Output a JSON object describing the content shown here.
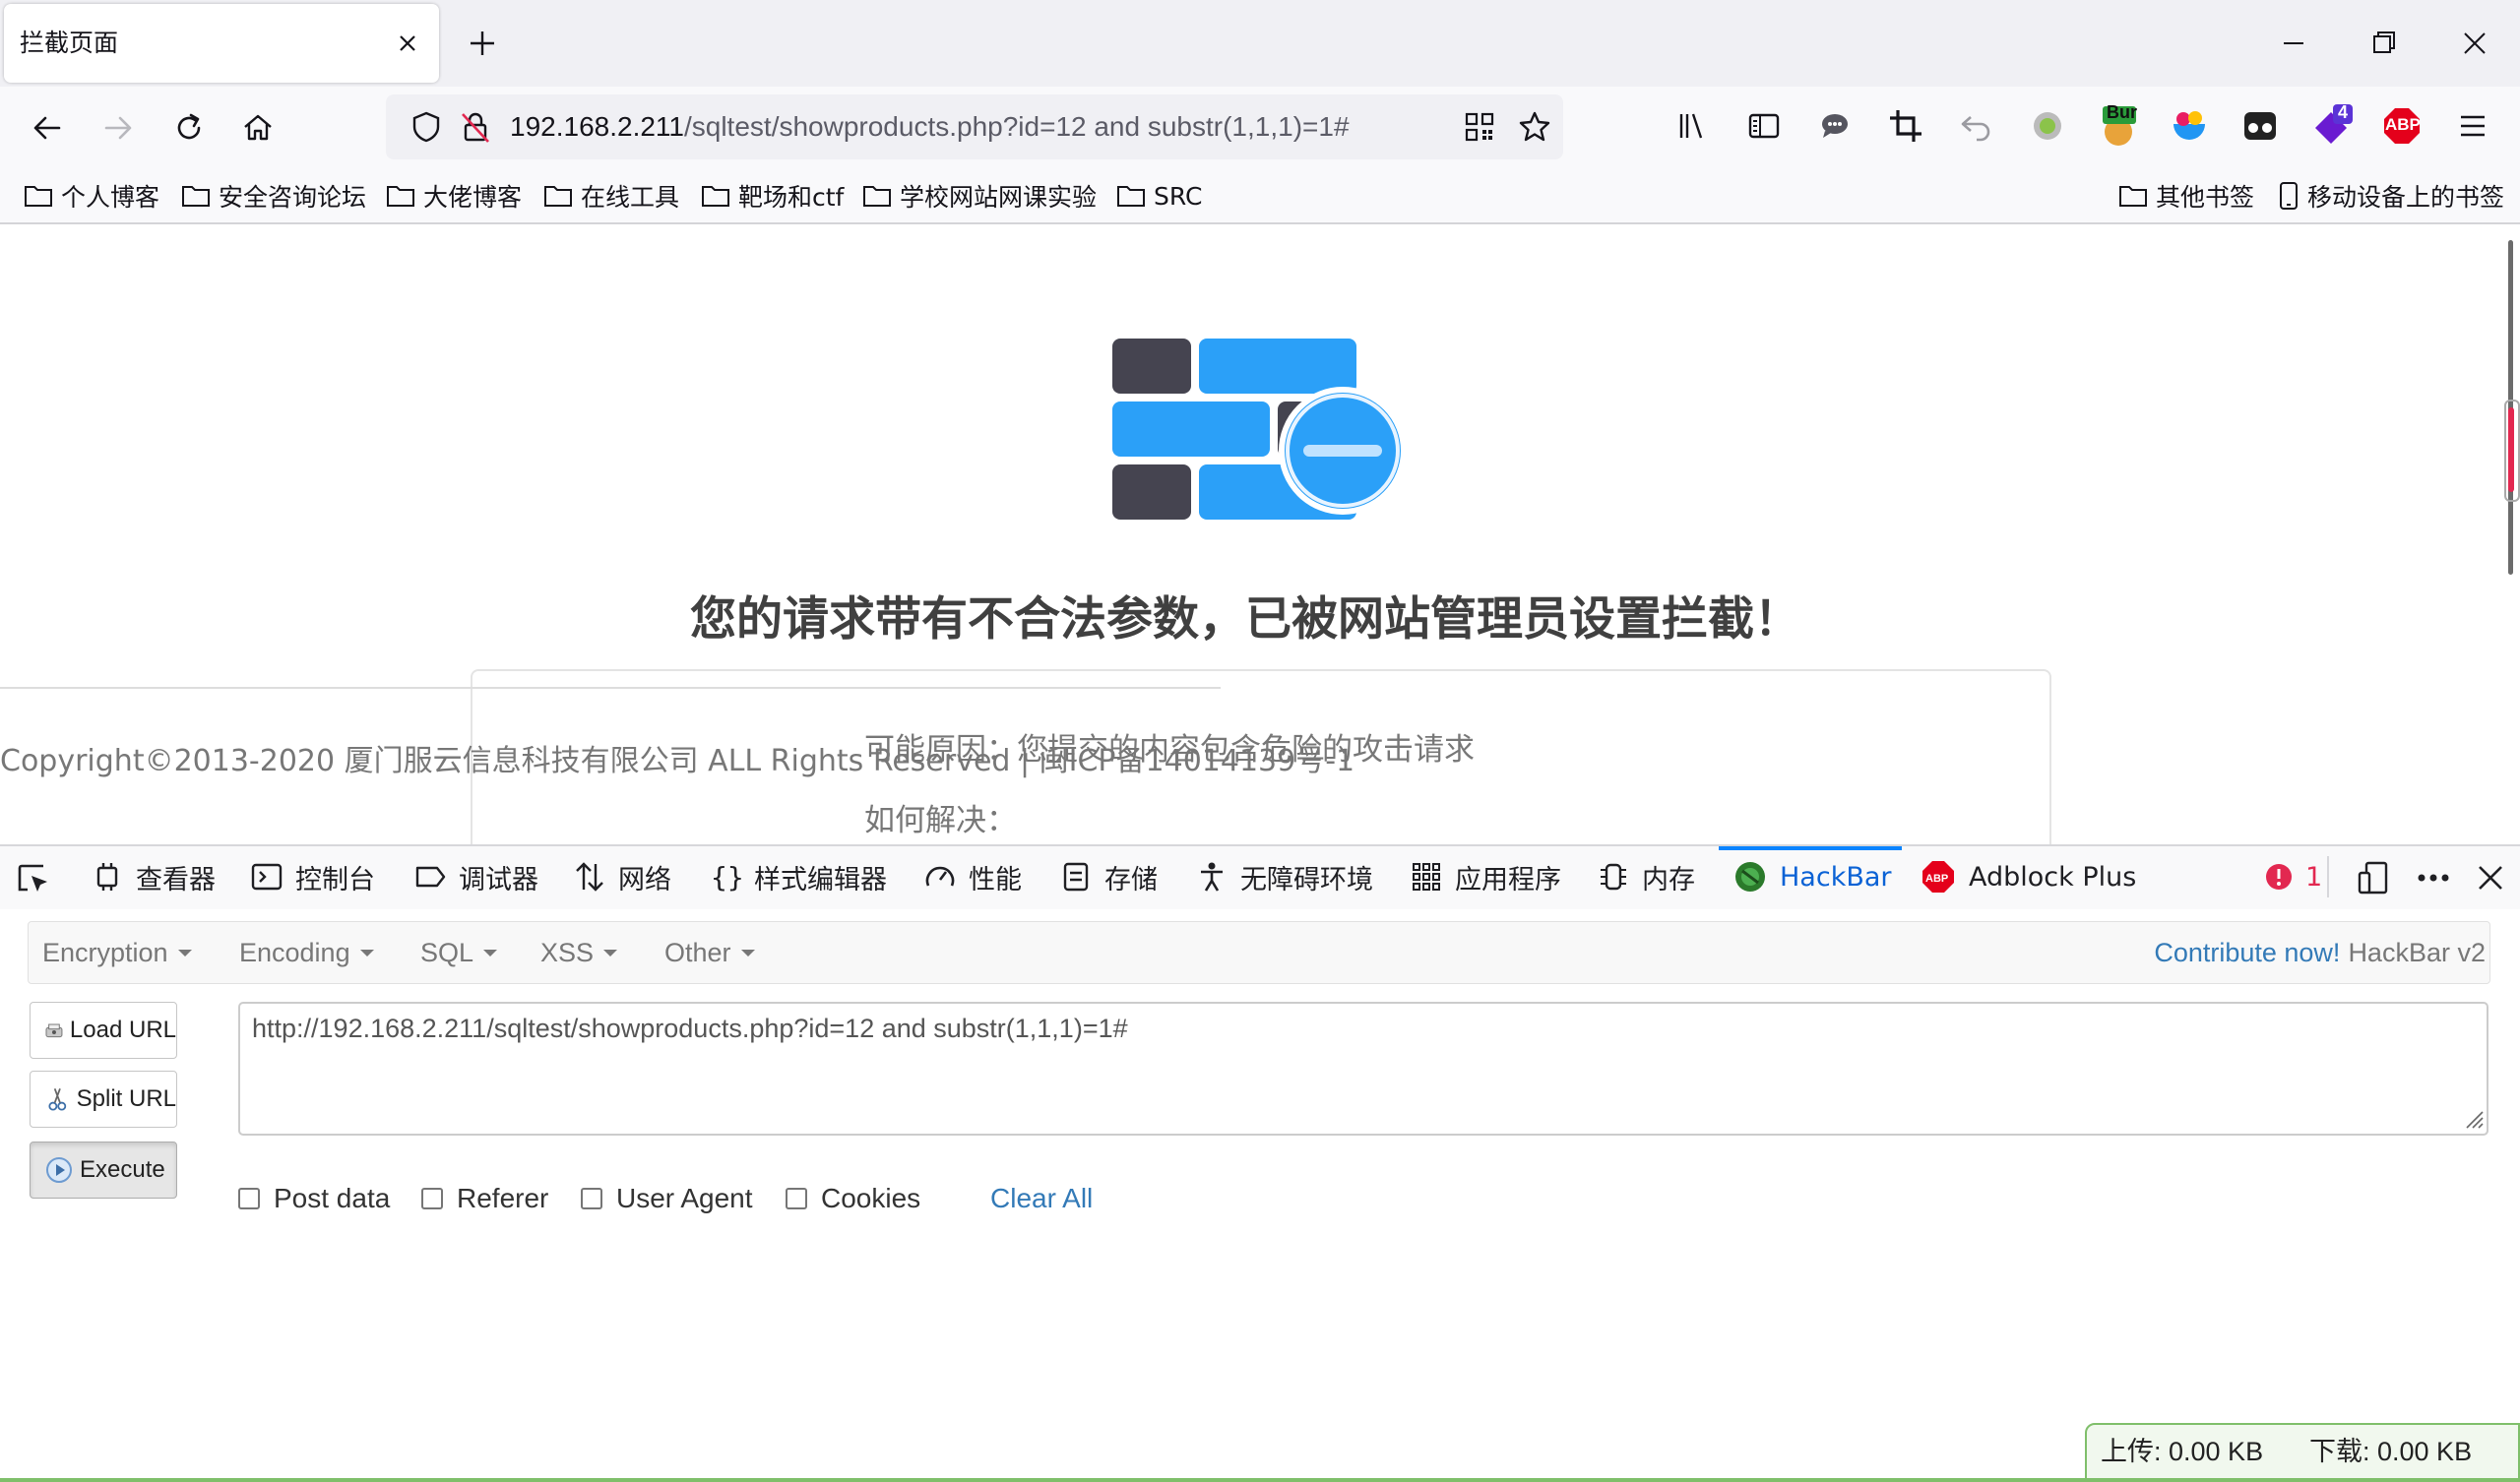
{
  "browser": {
    "tab_title": "拦截页面",
    "url_host": "192.168.2.211",
    "url_path": "/sqltest/showproducts.php?id=12 and substr(1,1,1)=1#",
    "extension_badges": {
      "burp": "Bur",
      "notif_count": "4",
      "abp": "ABP"
    }
  },
  "bookmarks": {
    "left": [
      "个人博客",
      "安全咨询论坛",
      "大佬博客",
      "在线工具",
      "靶场和ctf",
      "学校网站网课实验",
      "SRC"
    ],
    "right": [
      "其他书签",
      "移动设备上的书签"
    ]
  },
  "block_page": {
    "title": "您的请求带有不合法参数，已被网站管理员设置拦截！",
    "reason_label": "可能原因：您提交的内容包含危险的攻击请求",
    "howto_label": "如何解决：",
    "copyright": "Copyright©2013-2020 厦门服云信息科技有限公司 ALL Rights Reserved | 闽ICP备14014139号-1",
    "colors": {
      "blue": "#2ba0f8",
      "dark": "#454450",
      "title": "#404040"
    }
  },
  "devtools": {
    "tabs": [
      "查看器",
      "控制台",
      "调试器",
      "网络",
      "样式编辑器",
      "性能",
      "存储",
      "无障碍环境",
      "应用程序",
      "内存",
      "HackBar",
      "Adblock Plus"
    ],
    "active_tab": "HackBar",
    "error_count": "1"
  },
  "hackbar": {
    "menus": [
      "Encryption",
      "Encoding",
      "SQL",
      "XSS",
      "Other"
    ],
    "contribute_label": "Contribute now!",
    "version_label": "HackBar v2",
    "buttons": {
      "load": "Load URL",
      "split": "Split URL",
      "execute": "Execute"
    },
    "url_value": "http://192.168.2.211/sqltest/showproducts.php?id=12 and substr(1,1,1)=1#",
    "checkboxes": [
      "Post data",
      "Referer",
      "User Agent",
      "Cookies"
    ],
    "clear_all": "Clear All"
  },
  "netspeed": {
    "upload": "上传: 0.00 KB",
    "download": "下载: 0.00 KB"
  }
}
